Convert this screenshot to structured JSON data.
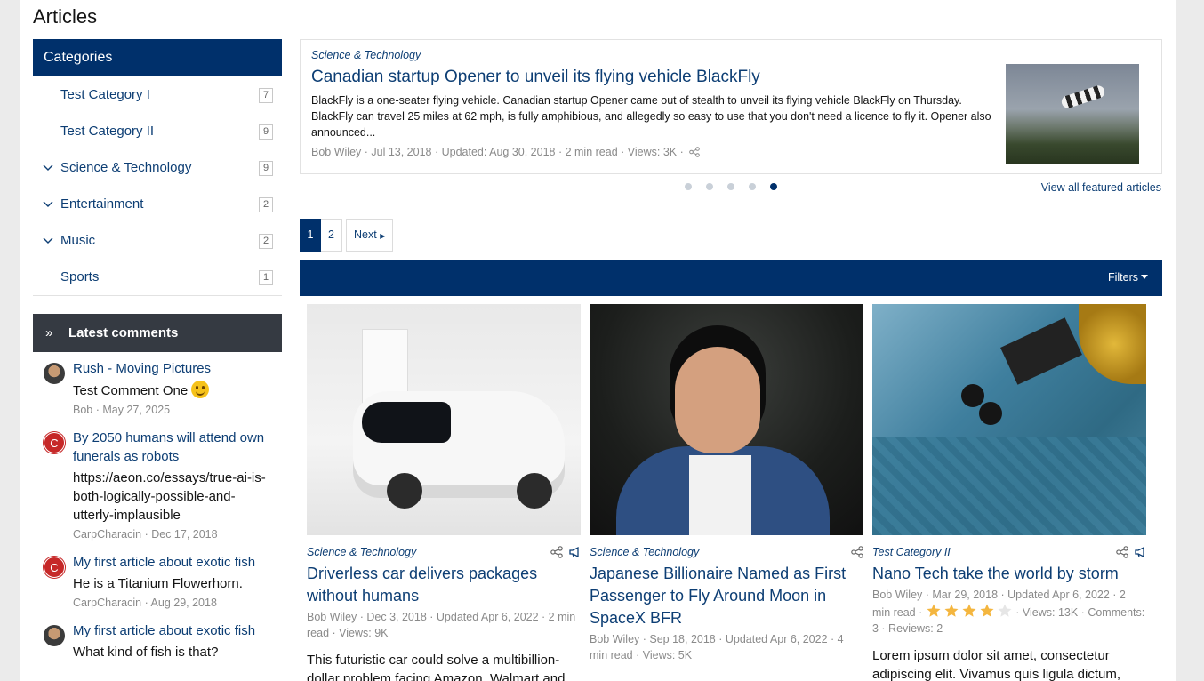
{
  "page": {
    "title": "Articles"
  },
  "categories": {
    "title": "Categories",
    "items": [
      {
        "label": "Test Category I",
        "count": "7",
        "expandable": false
      },
      {
        "label": "Test Category II",
        "count": "9",
        "expandable": false
      },
      {
        "label": "Science & Technology",
        "count": "9",
        "expandable": true
      },
      {
        "label": "Entertainment",
        "count": "2",
        "expandable": true
      },
      {
        "label": "Music",
        "count": "2",
        "expandable": true
      },
      {
        "label": "Sports",
        "count": "1",
        "expandable": false
      }
    ]
  },
  "latest_comments": {
    "title": "Latest comments",
    "items": [
      {
        "title": "Rush - Moving Pictures",
        "text": "Test Comment One",
        "meta": "Bob · May 27, 2025",
        "avatar": "photo"
      },
      {
        "title": "By 2050 humans will attend own funerals as robots",
        "text": "https://aeon.co/essays/true-ai-is-both-logically-possible-and-utterly-implausible",
        "meta": "CarpCharacin · Dec 17, 2018",
        "avatar": "C"
      },
      {
        "title": "My first article about exotic fish",
        "text": "He is a Titanium Flowerhorn.",
        "meta": "CarpCharacin · Aug 29, 2018",
        "avatar": "C"
      },
      {
        "title": "My first article about exotic fish",
        "text": "What kind of fish is that?",
        "meta": "",
        "avatar": "photo"
      }
    ]
  },
  "featured": {
    "category": "Science & Technology",
    "title": "Canadian startup Opener to unveil its flying vehicle BlackFly",
    "description": "BlackFly is a one-seater flying vehicle. Canadian startup Opener came out of stealth to unveil its flying vehicle BlackFly on Thursday. BlackFly can travel 25 miles at 62 mph, is fully amphibious, and allegedly so easy to use that you don't need a licence to fly it. Opener also announced...",
    "meta": "Bob Wiley · Jul 13, 2018 · Updated: Aug 30, 2018 · 2 min read · Views: 3K ·",
    "slide_count": 5,
    "active_slide": 5,
    "view_all": "View all featured articles"
  },
  "pagination": {
    "pages": [
      "1",
      "2"
    ],
    "current": "1",
    "next": "Next"
  },
  "filters": {
    "label": "Filters"
  },
  "articles": [
    {
      "category": "Science & Technology",
      "title": "Driverless car delivers packages without humans",
      "meta": "Bob Wiley · Dec 3, 2018 · Updated Apr 6, 2022 · 2 min read · Views: 9K",
      "excerpt": "This futuristic car could solve a multibillion-dollar problem facing Amazon, Walmart and"
    },
    {
      "category": "Science & Technology",
      "title": "Japanese Billionaire Named as First Passenger to Fly Around Moon in SpaceX BFR",
      "meta": "Bob Wiley · Sep 18, 2018 · Updated Apr 6, 2022 · 4 min read · Views: 5K",
      "excerpt": ""
    },
    {
      "category": "Test Category II",
      "title": "Nano Tech take the world by storm",
      "meta_a": "Bob Wiley · Mar 29, 2018 · Updated Apr 6, 2022 · 2 min read ·",
      "rating": 4,
      "rating_max": 5,
      "meta_b": "· Views: 13K ·",
      "meta_c": "Comments: 3 · Reviews: 2",
      "excerpt": "Lorem ipsum dolor sit amet, consectetur adipiscing elit. Vivamus quis ligula dictum,"
    }
  ],
  "colors": {
    "primary": "#00306b",
    "link": "#0d3e74",
    "dark_header": "#353a42",
    "star": "#f4b63f"
  }
}
